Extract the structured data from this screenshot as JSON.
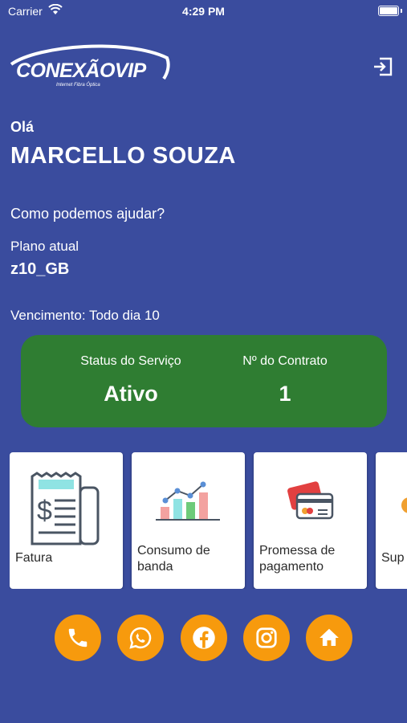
{
  "status_bar": {
    "carrier": "Carrier",
    "time": "4:29 PM"
  },
  "brand": {
    "name": "CONEXÃOVIP",
    "tagline": "Internet Fibra Óptica"
  },
  "header": {
    "greeting": "Olá",
    "user_name": "MARCELLO SOUZA",
    "help_text": "Como podemos ajudar?"
  },
  "plan": {
    "label": "Plano atual",
    "value": "z10_GB"
  },
  "due": {
    "text": "Vencimento: Todo dia 10"
  },
  "status_card": {
    "service_label": "Status do Serviço",
    "service_value": "Ativo",
    "contract_label": "Nº do Contrato",
    "contract_value": "1",
    "color": "#2f7d32"
  },
  "tiles": [
    {
      "label": "Fatura",
      "icon": "invoice-icon"
    },
    {
      "label": "Consumo de banda",
      "icon": "bandwidth-chart-icon"
    },
    {
      "label": "Promessa de pagamento",
      "icon": "credit-card-icon"
    },
    {
      "label": "Sup",
      "icon": "support-icon"
    }
  ],
  "social": [
    "phone-icon",
    "whatsapp-icon",
    "facebook-icon",
    "instagram-icon",
    "home-icon"
  ],
  "colors": {
    "background": "#3a4c9e",
    "accent": "#f79a0d"
  }
}
